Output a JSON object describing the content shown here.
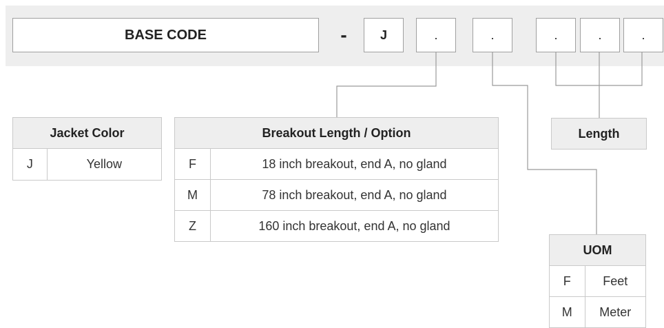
{
  "part_code": {
    "base_code": "BASE CODE",
    "separator": "-",
    "segments": [
      "J",
      ".",
      ".",
      ".",
      ".",
      "."
    ]
  },
  "tables": {
    "jacket_color": {
      "title": "Jacket Color",
      "rows": [
        {
          "code": "J",
          "description": "Yellow"
        }
      ]
    },
    "breakout": {
      "title": "Breakout Length / Option",
      "rows": [
        {
          "code": "F",
          "description": "18 inch breakout, end A, no gland"
        },
        {
          "code": "M",
          "description": "78 inch breakout, end A, no gland"
        },
        {
          "code": "Z",
          "description": "160 inch breakout, end A, no gland"
        }
      ]
    },
    "length": {
      "title": "Length"
    },
    "uom": {
      "title": "UOM",
      "rows": [
        {
          "code": "F",
          "description": "Feet"
        },
        {
          "code": "M",
          "description": "Meter"
        }
      ]
    }
  },
  "colors": {
    "band": "#eeeeee",
    "border": "#c9c9c9",
    "connector": "#9a9a9a",
    "text": "#222222"
  }
}
